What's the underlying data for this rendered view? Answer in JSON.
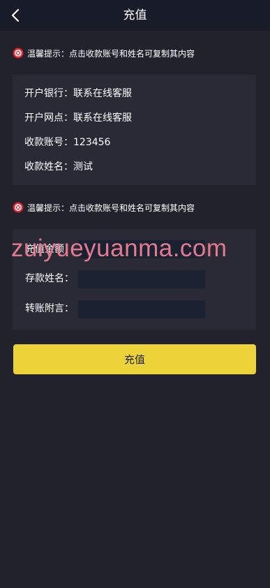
{
  "header": {
    "title": "充值"
  },
  "tips": [
    {
      "text": "温馨提示：点击收款账号和姓名可复制其内容"
    },
    {
      "text": "温馨提示：点击收款账号和姓名可复制其内容"
    }
  ],
  "bank_info": {
    "rows": [
      {
        "label": "开户银行：",
        "value": "联系在线客服"
      },
      {
        "label": "开户网点：",
        "value": "联系在线客服"
      },
      {
        "label": "收款账号：",
        "value": "123456"
      },
      {
        "label": "收款姓名：",
        "value": "测试"
      }
    ]
  },
  "form": {
    "amount_label": "充值金额：",
    "name_label": "存款姓名：",
    "note_label": "转账附言：",
    "amount_value": "",
    "name_value": "",
    "note_value": ""
  },
  "submit_label": "充值",
  "watermark": "zuiyueyuanma.com",
  "colors": {
    "background": "#22222c",
    "header": "#171c28",
    "card": "#292a35",
    "input": "#1a2131",
    "button": "#ecd33a",
    "tip_icon": "#e0202a"
  }
}
